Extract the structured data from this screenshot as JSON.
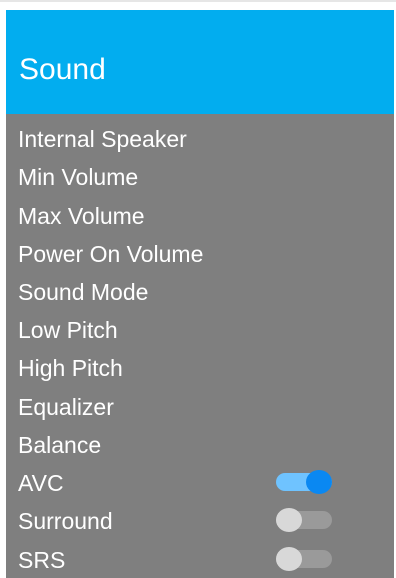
{
  "header": {
    "title": "Sound",
    "background_color": "#02adef"
  },
  "menu": {
    "background_color": "#7f7f7f",
    "items": [
      {
        "label": "Internal Speaker"
      },
      {
        "label": "Min Volume"
      },
      {
        "label": "Max Volume"
      },
      {
        "label": "Power On Volume"
      },
      {
        "label": "Sound Mode"
      },
      {
        "label": "Low Pitch"
      },
      {
        "label": "High Pitch"
      },
      {
        "label": "Equalizer"
      },
      {
        "label": "Balance"
      },
      {
        "label": "AVC",
        "toggle": "on"
      },
      {
        "label": "Surround",
        "toggle": "off"
      },
      {
        "label": "SRS",
        "toggle": "off"
      }
    ]
  },
  "toggle_colors": {
    "on_track": "#6fc3ff",
    "on_knob": "#0a88f2",
    "off_track": "#9a9a9a",
    "off_knob": "#d8d8d8"
  }
}
